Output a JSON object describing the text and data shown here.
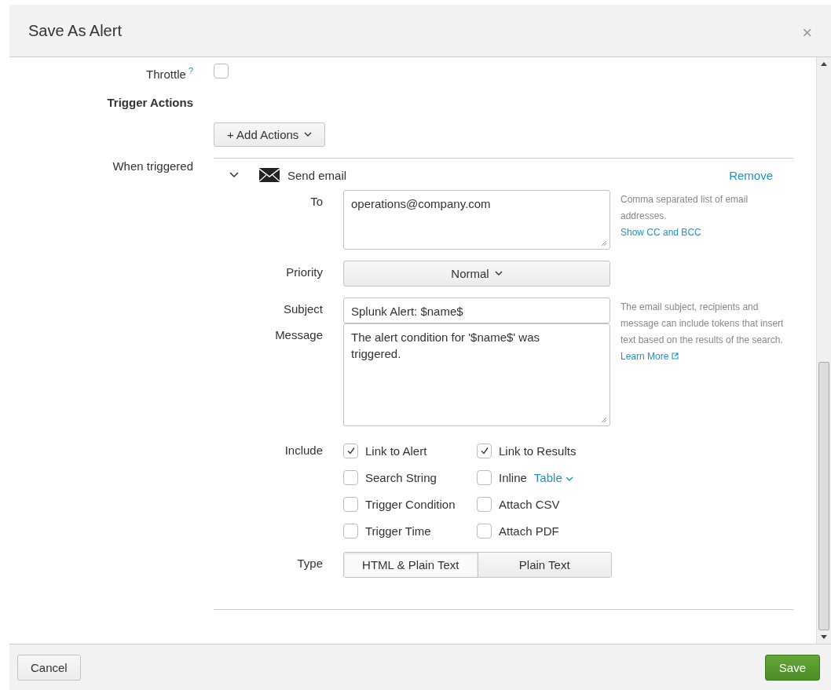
{
  "dialog": {
    "title": "Save As Alert",
    "close": "×"
  },
  "throttle": {
    "label": "Throttle",
    "help": "?",
    "checked": false
  },
  "trigger_actions": {
    "heading": "Trigger Actions",
    "add_button": "+ Add Actions"
  },
  "when_triggered": {
    "label": "When triggered",
    "action": {
      "name": "Send email",
      "expanded": true,
      "remove": "Remove"
    }
  },
  "email": {
    "to": {
      "label": "To",
      "value": "operations@company.com",
      "help": "Comma separated list of email addresses.",
      "link": "Show CC and BCC"
    },
    "priority": {
      "label": "Priority",
      "value": "Normal"
    },
    "subject": {
      "label": "Subject",
      "value": "Splunk Alert: $name$",
      "help": "The email subject, recipients and message can include tokens that insert text based on the results of the search.",
      "link": "Learn More"
    },
    "message": {
      "label": "Message",
      "value": "The alert condition for '$name$' was triggered."
    },
    "include": {
      "label": "Include",
      "options": [
        {
          "label": "Link to Alert",
          "checked": true
        },
        {
          "label": "Link to Results",
          "checked": true
        },
        {
          "label": "Search String",
          "checked": false
        },
        {
          "label": "Inline",
          "checked": false,
          "format": "Table"
        },
        {
          "label": "Trigger Condition",
          "checked": false
        },
        {
          "label": "Attach CSV",
          "checked": false
        },
        {
          "label": "Trigger Time",
          "checked": false
        },
        {
          "label": "Attach PDF",
          "checked": false
        }
      ]
    },
    "type": {
      "label": "Type",
      "options": [
        {
          "label": "HTML & Plain Text",
          "selected": true
        },
        {
          "label": "Plain Text",
          "selected": false
        }
      ]
    }
  },
  "footer": {
    "cancel": "Cancel",
    "save": "Save"
  }
}
